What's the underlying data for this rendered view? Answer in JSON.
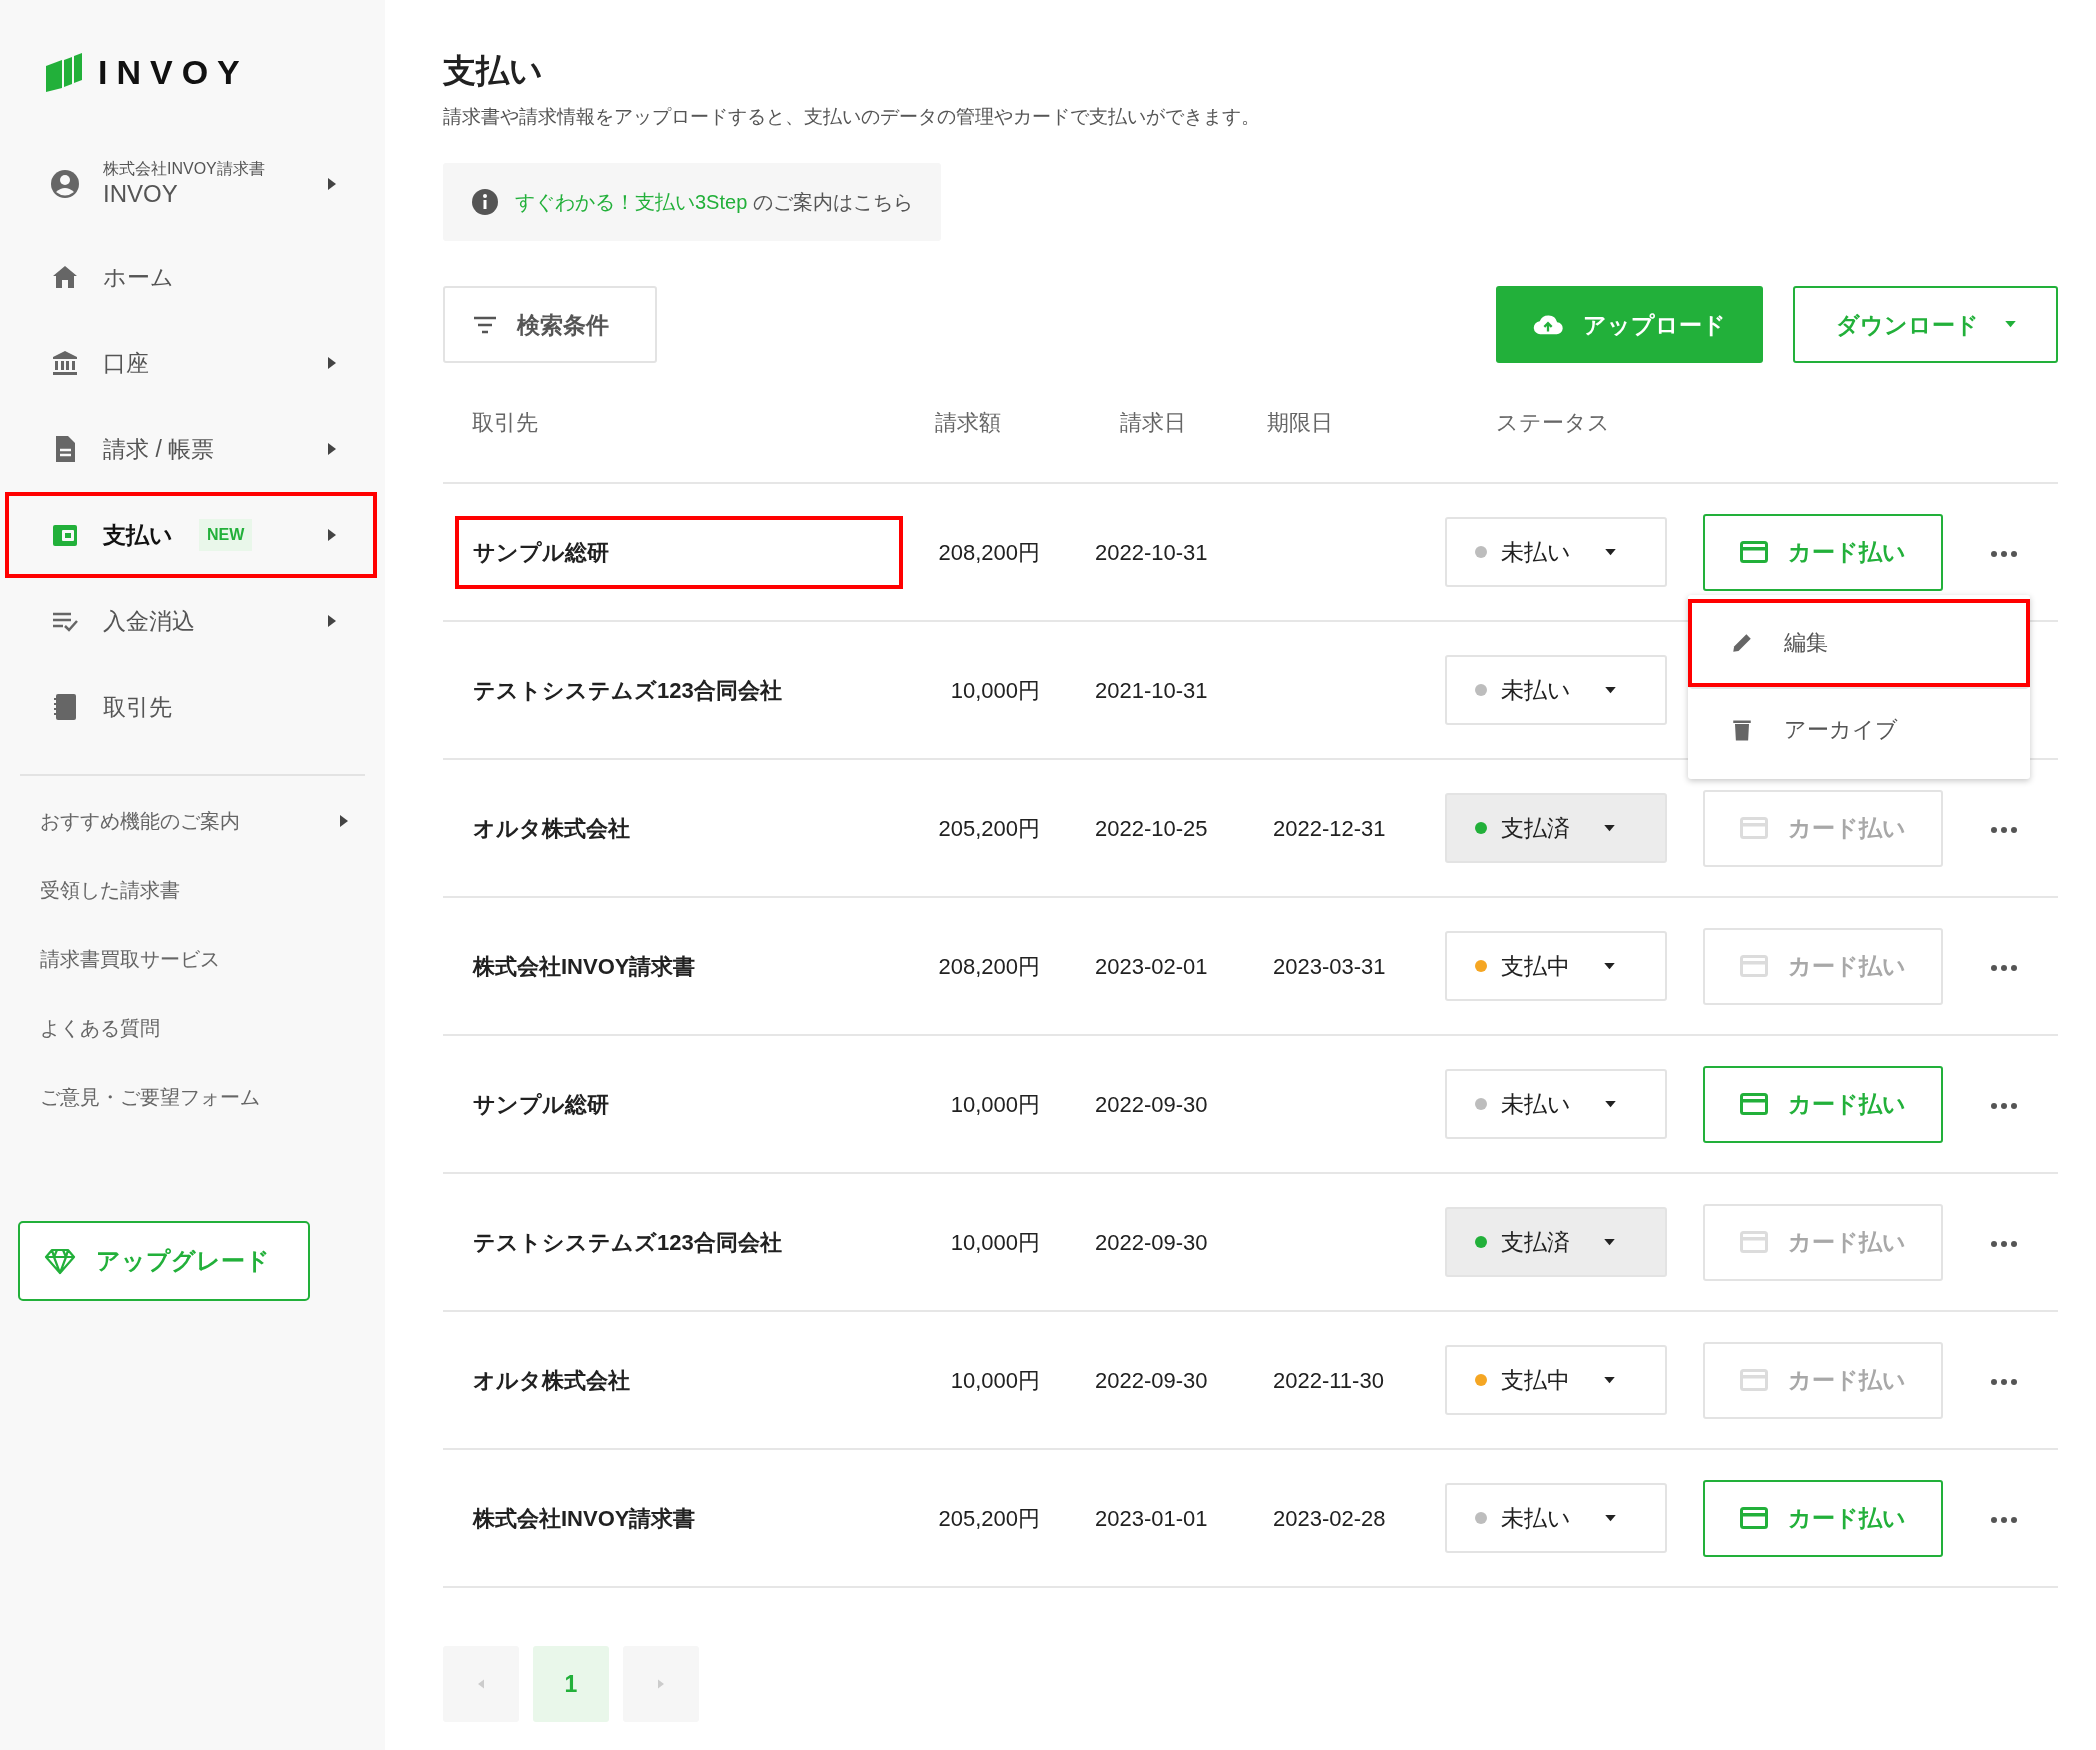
{
  "sidebar": {
    "logo": "INVOY",
    "account": {
      "company": "株式会社INVOY請求書",
      "name": "INVOY",
      "chevron": true
    },
    "nav": [
      {
        "label": "ホーム",
        "chevron": false,
        "selected": false,
        "highlighted": false
      },
      {
        "label": "口座",
        "chevron": true,
        "selected": false,
        "highlighted": false
      },
      {
        "label": "請求 / 帳票",
        "chevron": true,
        "selected": false,
        "highlighted": false
      },
      {
        "label": "支払い",
        "chevron": true,
        "selected": true,
        "highlighted": true,
        "badge": "NEW"
      },
      {
        "label": "入金消込",
        "chevron": true,
        "selected": false,
        "highlighted": false
      },
      {
        "label": "取引先",
        "chevron": false,
        "selected": false,
        "highlighted": false
      }
    ],
    "links": [
      {
        "label": "おすすめ機能のご案内",
        "chevron": true
      },
      {
        "label": "受領した請求書",
        "chevron": false
      },
      {
        "label": "請求書買取サービス",
        "chevron": false
      },
      {
        "label": "よくある質問",
        "chevron": false
      },
      {
        "label": "ご意見・ご要望フォーム",
        "chevron": false
      }
    ],
    "upgrade_button": "アップグレード"
  },
  "page": {
    "title": "支払い",
    "description": "請求書や請求情報をアップロードすると、支払いのデータの管理やカードで支払いができます。",
    "info": {
      "link": "すぐわかる！支払い3Step",
      "text": "のご案内はこちら"
    }
  },
  "toolbar": {
    "filter_button": "検索条件",
    "upload_button": "アップロード",
    "download_button": "ダウンロード"
  },
  "table": {
    "columns": [
      "取引先",
      "請求額",
      "請求日",
      "期限日",
      "ステータス"
    ],
    "rows": [
      {
        "partner": "サンプル総研",
        "amount": "208,200円",
        "invoice_date": "2022-10-31",
        "status": {
          "label": "未払い",
          "color": "#bdbdbd",
          "filled": false
        },
        "card_button": "カード払い",
        "card_enabled": true,
        "highlighted": true,
        "menu_open": true
      },
      {
        "partner": "テストシステムズ123合同会社",
        "amount": "10,000円",
        "invoice_date": "2021-10-31",
        "status": {
          "label": "未払い",
          "color": "#bdbdbd",
          "filled": false
        },
        "highlighted": false,
        "menu_open": false
      },
      {
        "partner": "オルタ株式会社",
        "amount": "205,200円",
        "invoice_date": "2022-10-25",
        "due_date": "2022-12-31",
        "status": {
          "label": "支払済",
          "color": "#22b03a",
          "filled": true
        },
        "card_button": "カード払い",
        "card_enabled": false,
        "highlighted": false,
        "menu_open": false
      },
      {
        "partner": "株式会社INVOY請求書",
        "amount": "208,200円",
        "invoice_date": "2023-02-01",
        "due_date": "2023-03-31",
        "status": {
          "label": "支払中",
          "color": "#f5a623",
          "filled": false
        },
        "card_button": "カード払い",
        "card_enabled": false,
        "highlighted": false,
        "menu_open": false
      },
      {
        "partner": "サンプル総研",
        "amount": "10,000円",
        "invoice_date": "2022-09-30",
        "status": {
          "label": "未払い",
          "color": "#bdbdbd",
          "filled": false
        },
        "card_button": "カード払い",
        "card_enabled": true,
        "highlighted": false,
        "menu_open": false
      },
      {
        "partner": "テストシステムズ123合同会社",
        "amount": "10,000円",
        "invoice_date": "2022-09-30",
        "status": {
          "label": "支払済",
          "color": "#22b03a",
          "filled": true
        },
        "card_button": "カード払い",
        "card_enabled": false,
        "highlighted": false,
        "menu_open": false
      },
      {
        "partner": "オルタ株式会社",
        "amount": "10,000円",
        "invoice_date": "2022-09-30",
        "due_date": "2022-11-30",
        "status": {
          "label": "支払中",
          "color": "#f5a623",
          "filled": false
        },
        "card_button": "カード払い",
        "card_enabled": false,
        "highlighted": false,
        "menu_open": false
      },
      {
        "partner": "株式会社INVOY請求書",
        "amount": "205,200円",
        "invoice_date": "2023-01-01",
        "due_date": "2023-02-28",
        "status": {
          "label": "未払い",
          "color": "#bdbdbd",
          "filled": false
        },
        "card_button": "カード払い",
        "card_enabled": true,
        "highlighted": false,
        "menu_open": false
      }
    ],
    "row_menu": [
      {
        "label": "編集",
        "highlighted": true
      },
      {
        "label": "アーカイブ",
        "highlighted": false
      }
    ]
  },
  "pagination": {
    "pages": [
      {
        "label": "1",
        "selected": true
      }
    ]
  }
}
